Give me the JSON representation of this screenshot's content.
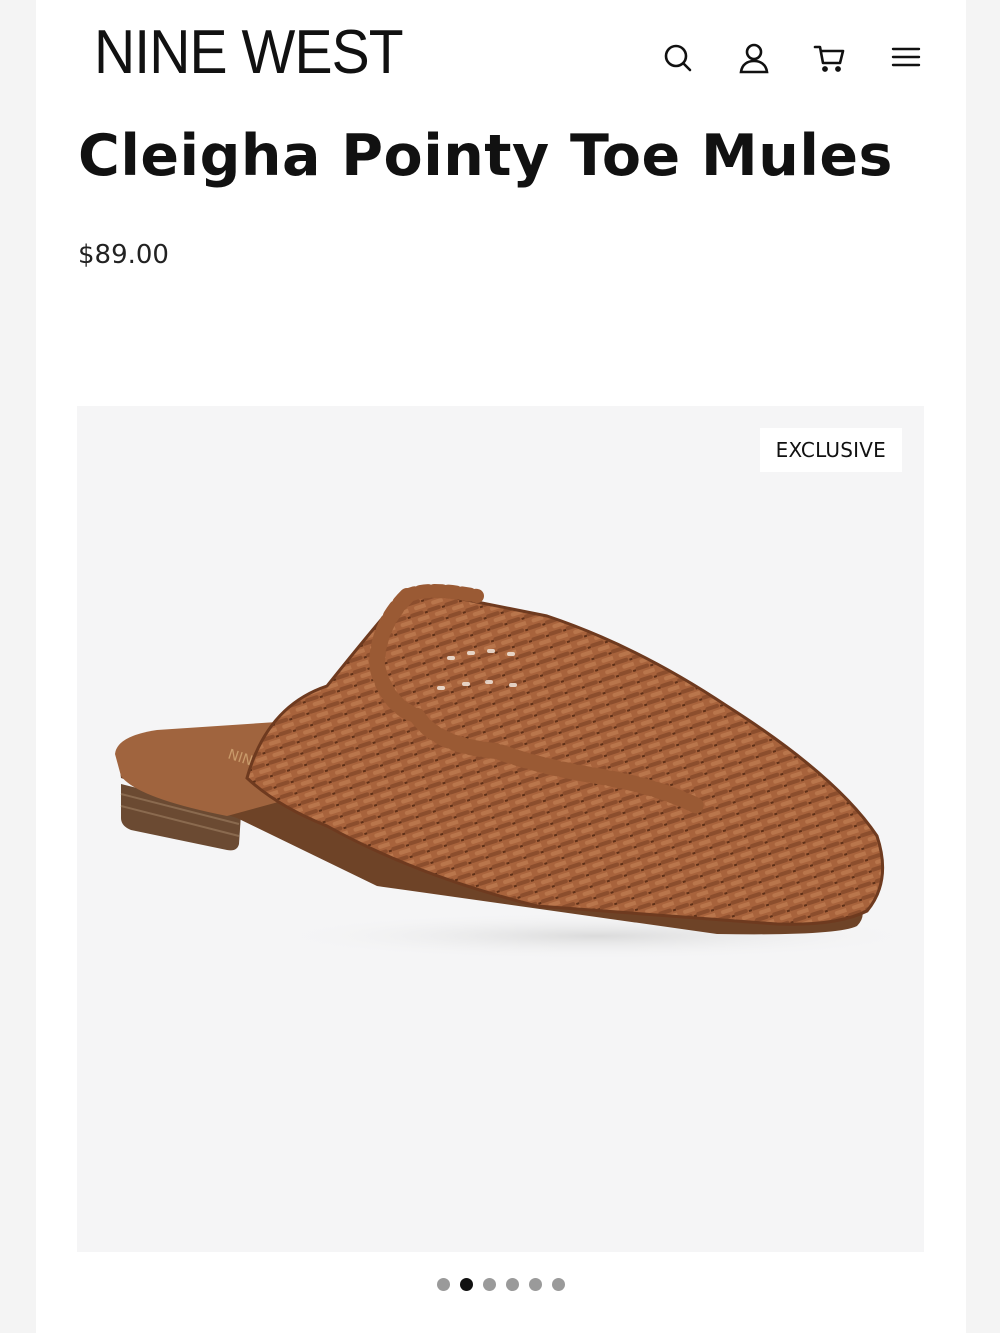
{
  "header": {
    "logo": "NINE WEST",
    "icons": [
      "search-icon",
      "account-icon",
      "cart-icon",
      "menu-icon"
    ]
  },
  "product": {
    "title": "Cleigha Pointy Toe Mules",
    "price": "$89.00",
    "badge": "EXCLUSIVE",
    "image_alt": "Brown woven raffia pointy toe mule"
  },
  "carousel": {
    "total": 6,
    "active_index": 1
  },
  "colors": {
    "page_bg": "#ffffff",
    "text": "#111111",
    "shoe_main": "#a8633c",
    "shoe_dark": "#6e3a1f",
    "insole": "#a0643e",
    "dot_inactive": "#9a9a9a",
    "dot_active": "#111111"
  }
}
